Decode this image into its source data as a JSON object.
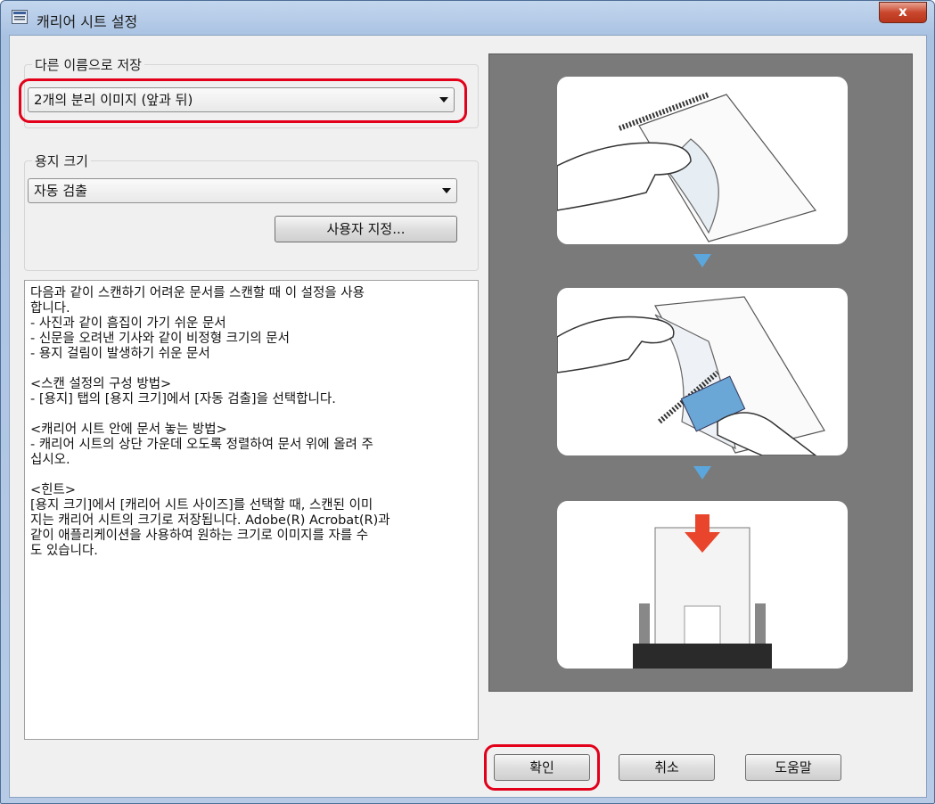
{
  "window": {
    "title": "캐리어 시트 설정",
    "close_label": "x"
  },
  "save_as": {
    "group_label": "다른 이름으로 저장",
    "selected": "2개의 분리 이미지 (앞과 뒤)"
  },
  "paper_size": {
    "group_label": "용지 크기",
    "selected": "자동 검출",
    "custom_button": "사용자 지정..."
  },
  "description": "다음과 같이 스캔하기 어려운 문서를 스캔할 때 이 설정을 사용\n합니다.\n- 사진과 같이 흠집이 가기 쉬운 문서\n- 신문을 오려낸 기사와 같이 비정형 크기의 문서\n- 용지 걸림이 발생하기 쉬운 문서\n\n<스캔 설정의 구성 방법>\n- [용지] 탭의 [용지 크기]에서 [자동 검출]을 선택합니다.\n\n<캐리어 시트 안에 문서 놓는 방법>\n- 캐리어 시트의 상단 가운데 오도록 정렬하여 문서 위에 올려 주\n십시오.\n\n<힌트>\n[용지 크기]에서 [캐리어 시트 사이즈]를 선택할 때, 스캔된 이미\n지는 캐리어 시트의 크기로 저장됩니다. Adobe(R) Acrobat(R)과\n같이 애플리케이션을 사용하여 원하는 크기로 이미지를 자를 수\n도 있습니다.",
  "buttons": {
    "ok": "확인",
    "cancel": "취소",
    "help": "도움말"
  },
  "colors": {
    "highlight": "#e2001a",
    "step_arrow": "#5ba7dd",
    "preview_bg": "#7a7a7a"
  }
}
